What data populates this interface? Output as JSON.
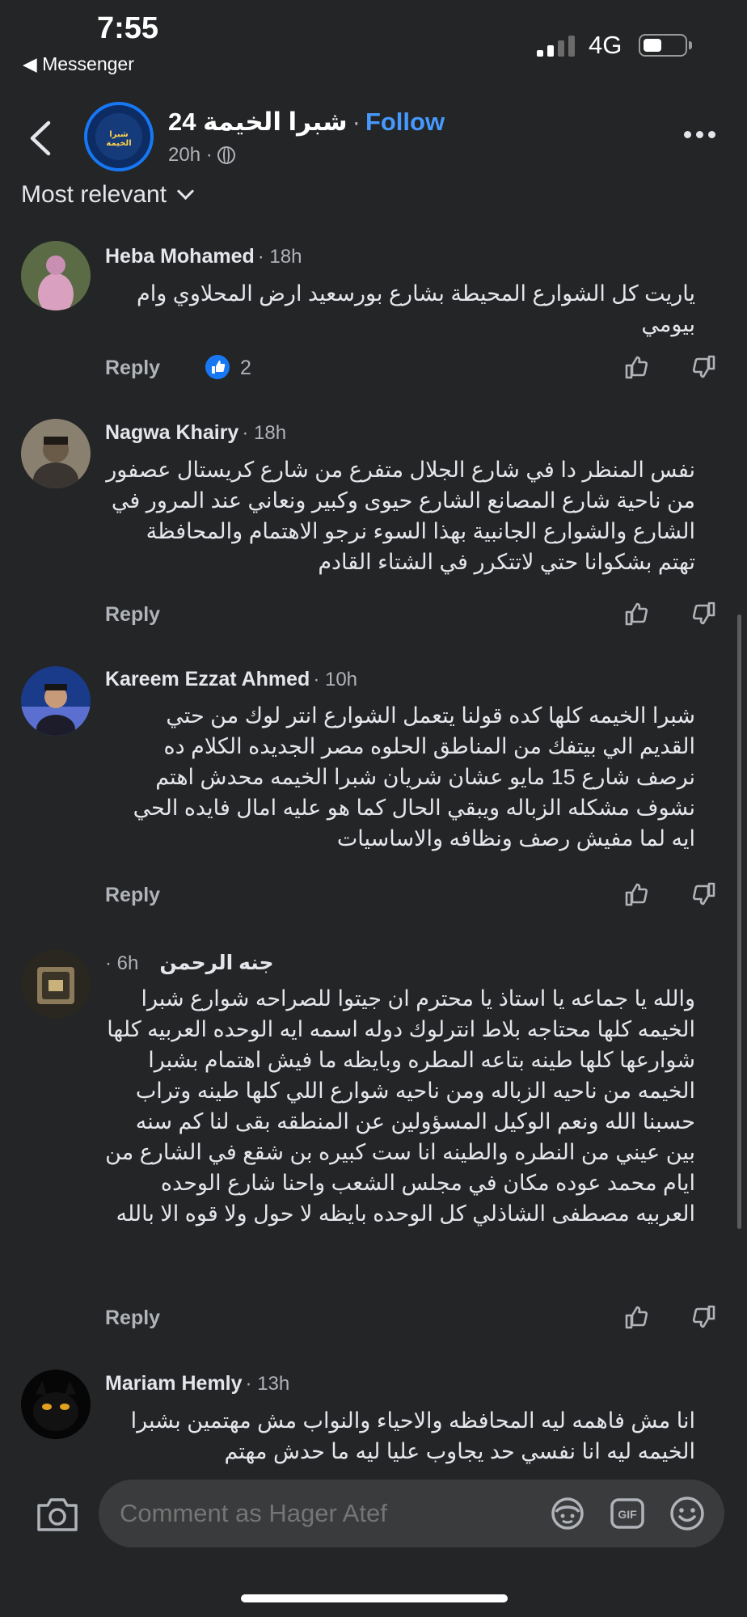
{
  "status_bar": {
    "time": "7:55",
    "back_app": "◀ Messenger",
    "network": "4G"
  },
  "header": {
    "page_name": "شبرا الخيمة 24",
    "separator": "·",
    "follow_label": "Follow",
    "post_age": "20h ·",
    "avatar_text": "شبرا الخيمة"
  },
  "sort_label": "Most relevant",
  "comments": [
    {
      "author": "Heba Mohamed",
      "time": "· 18h",
      "text": "ياريت كل الشوارع المحيطة بشارع بورسعيد ارض المحلاوي وام بيومي",
      "reply_label": "Reply",
      "like_count": "2"
    },
    {
      "author": "Nagwa Khairy",
      "time": "· 18h",
      "text": "نفس المنظر دا في شارع الجلال متفرع من شارع كريستال عصفور من ناحية شارع المصانع الشارع حيوى وكبير ونعاني عند المرور في الشارع والشوارع الجانبية بهذا السوء نرجو الاهتمام والمحافظة تهتم بشكوانا حتي لاتتكرر في الشتاء القادم",
      "reply_label": "Reply"
    },
    {
      "author": "Kareem Ezzat Ahmed",
      "time": "· 10h",
      "text": "شبرا الخيمه كلها كده قولنا يتعمل الشوارع انتر لوك من حتي القديم الي بيتفك من المناطق الحلوه مصر الجديده الكلام ده نرصف شارع 15 مايو عشان شريان شبرا الخيمه محدش اهتم نشوف مشكله الزباله ويبقي الحال كما هو عليه امال فايده الحي ايه لما مفيش رصف ونظافه والاساسيات",
      "reply_label": "Reply"
    },
    {
      "author": "جنه الرحمن",
      "time": "6h ·",
      "text": "والله يا جماعه يا استاذ يا محترم ان جيتوا للصراحه شوارع شبرا الخيمه كلها محتاجه بلاط انترلوك دوله اسمه ايه الوحده العربيه كلها شوارعها كلها طينه بتاعه المطره وبايظه ما فيش اهتمام بشبرا الخيمه من ناحيه الزباله ومن ناحيه شوارع اللي كلها طينه وتراب حسبنا الله ونعم الوكيل المسؤولين عن المنطقه بقى لنا كم سنه بين عيني من النطره والطينه انا ست كبيره بن شقع في الشارع من ايام محمد عوده مكان في مجلس الشعب واحنا شارع الوحده العربيه مصطفى الشاذلي كل الوحده بايظه لا حول ولا قوه الا بالله",
      "reply_label": "Reply"
    },
    {
      "author": "Mariam Hemly",
      "time": "· 13h",
      "text": "انا مش فاهمه ليه المحافظه والاحياء والنواب مش مهتمين بشبرا الخيمه ليه انا نفسي حد يجاوب عليا ليه ما حدش مهتم"
    }
  ],
  "composer": {
    "placeholder": "Comment as Hager Atef"
  },
  "icons": {
    "back": "chevron-left-icon",
    "globe": "globe-icon",
    "more": "more-icon",
    "like": "thumbs-up-icon",
    "dislike": "thumbs-down-icon",
    "camera": "camera-icon",
    "avatar_sticker": "avatar-sticker-icon",
    "gif": "gif-icon",
    "emoji": "emoji-icon"
  },
  "colors": {
    "background": "#242526",
    "accent": "#1877f2",
    "follow": "#4599ff",
    "input": "#3a3b3c"
  }
}
